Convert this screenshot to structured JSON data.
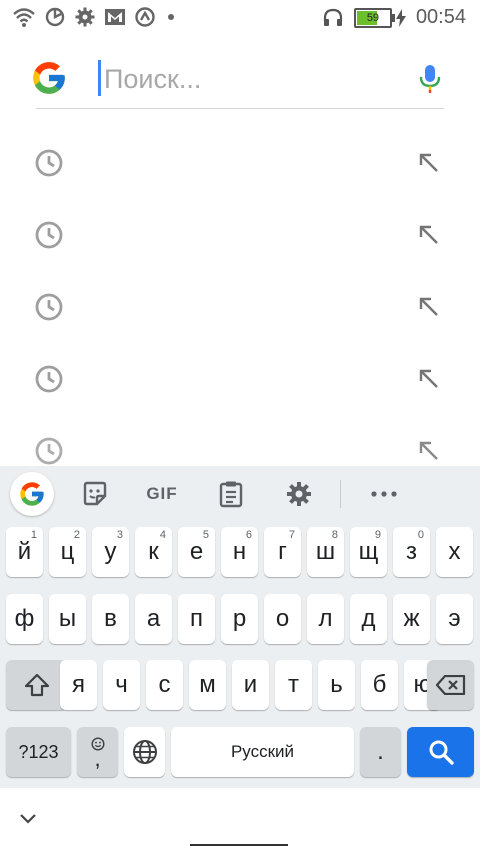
{
  "statusbar": {
    "icons": [
      "wifi-icon",
      "data-saver-icon",
      "settings-icon",
      "gmail-icon",
      "sync-icon",
      "notification-dot"
    ],
    "right_icons": [
      "headphones-icon",
      "battery-icon",
      "charging-bolt-icon"
    ],
    "battery_level": "59",
    "battery_fraction": 0.59,
    "time": "00:54"
  },
  "search": {
    "placeholder": "Поиск...",
    "value": "",
    "mic_icon": "microphone-icon",
    "logo_icon": "google-g-icon"
  },
  "suggestions": [
    {
      "icon": "history-clock-icon",
      "action_icon": "arrow-up-left-icon"
    },
    {
      "icon": "history-clock-icon",
      "action_icon": "arrow-up-left-icon"
    },
    {
      "icon": "history-clock-icon",
      "action_icon": "arrow-up-left-icon"
    },
    {
      "icon": "history-clock-icon",
      "action_icon": "arrow-up-left-icon"
    },
    {
      "icon": "history-clock-icon",
      "action_icon": "arrow-up-left-icon"
    }
  ],
  "keyboard": {
    "toolbar": {
      "google_icon": "google-g-icon",
      "sticker_icon": "sticker-icon",
      "gif_label": "GIF",
      "clipboard_icon": "clipboard-icon",
      "settings_icon": "gear-icon",
      "more_icon": "more-horiz-icon"
    },
    "row1": [
      {
        "label": "й",
        "hint": "1"
      },
      {
        "label": "ц",
        "hint": "2"
      },
      {
        "label": "у",
        "hint": "3"
      },
      {
        "label": "к",
        "hint": "4"
      },
      {
        "label": "е",
        "hint": "5"
      },
      {
        "label": "н",
        "hint": "6"
      },
      {
        "label": "г",
        "hint": "7"
      },
      {
        "label": "ш",
        "hint": "8"
      },
      {
        "label": "щ",
        "hint": "9"
      },
      {
        "label": "з",
        "hint": "0"
      },
      {
        "label": "х",
        "hint": ""
      }
    ],
    "row2": [
      "ф",
      "ы",
      "в",
      "а",
      "п",
      "р",
      "о",
      "л",
      "д",
      "ж",
      "э"
    ],
    "row3": [
      "я",
      "ч",
      "с",
      "м",
      "и",
      "т",
      "ь",
      "б",
      "ю"
    ],
    "shift_icon": "shift-arrow-icon",
    "backspace_icon": "backspace-icon",
    "symbols_label": "?123",
    "emoji_icon": "emoji-icon",
    "comma_label": ",",
    "globe_icon": "globe-icon",
    "space_label": "Русский",
    "period_label": ".",
    "search_key_icon": "search-icon"
  },
  "navbar": {
    "chevron_icon": "chevron-down-icon"
  },
  "colors": {
    "accent": "#1a73e8",
    "cursor": "#4285f4",
    "battery": "#6abf2a",
    "keyboard_bg": "#eceff1"
  }
}
